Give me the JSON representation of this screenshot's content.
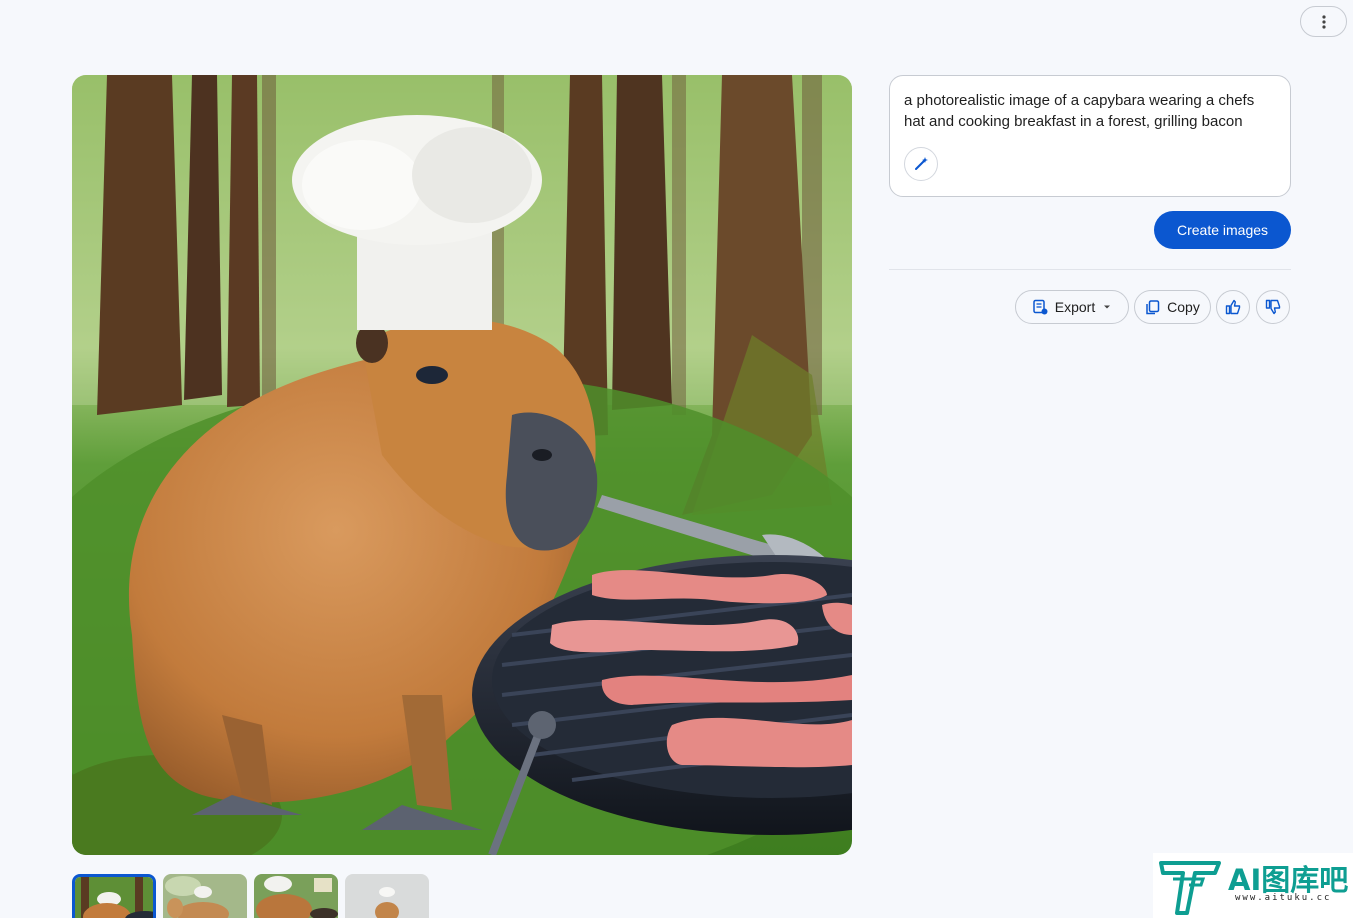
{
  "header": {
    "more_menu_icon": "more-vert-icon"
  },
  "generated_image": {
    "subject": "capybara-chef",
    "selected_index": 0
  },
  "prompt": {
    "text": "a photorealistic image of a capybara wearing a chefs hat and cooking breakfast in a forest, grilling bacon",
    "enhance_icon": "magic-wand-icon"
  },
  "create_button": {
    "label": "Create images"
  },
  "actions": {
    "export": {
      "label": "Export",
      "icon": "export-sheet-icon",
      "dropdown_icon": "caret-down-icon"
    },
    "copy": {
      "label": "Copy",
      "icon": "copy-icon"
    },
    "like_icon": "thumb-up-icon",
    "dislike_icon": "thumb-down-icon"
  },
  "thumbnails": [
    {
      "name": "thumbnail-1"
    },
    {
      "name": "thumbnail-2"
    },
    {
      "name": "thumbnail-3"
    },
    {
      "name": "thumbnail-4"
    }
  ],
  "watermark": {
    "title": "AI图库吧",
    "url": "www.aituku.cc"
  },
  "colors": {
    "accent": "#0b57d0",
    "background": "#f6f8fc",
    "watermark": "#0e9e92"
  }
}
